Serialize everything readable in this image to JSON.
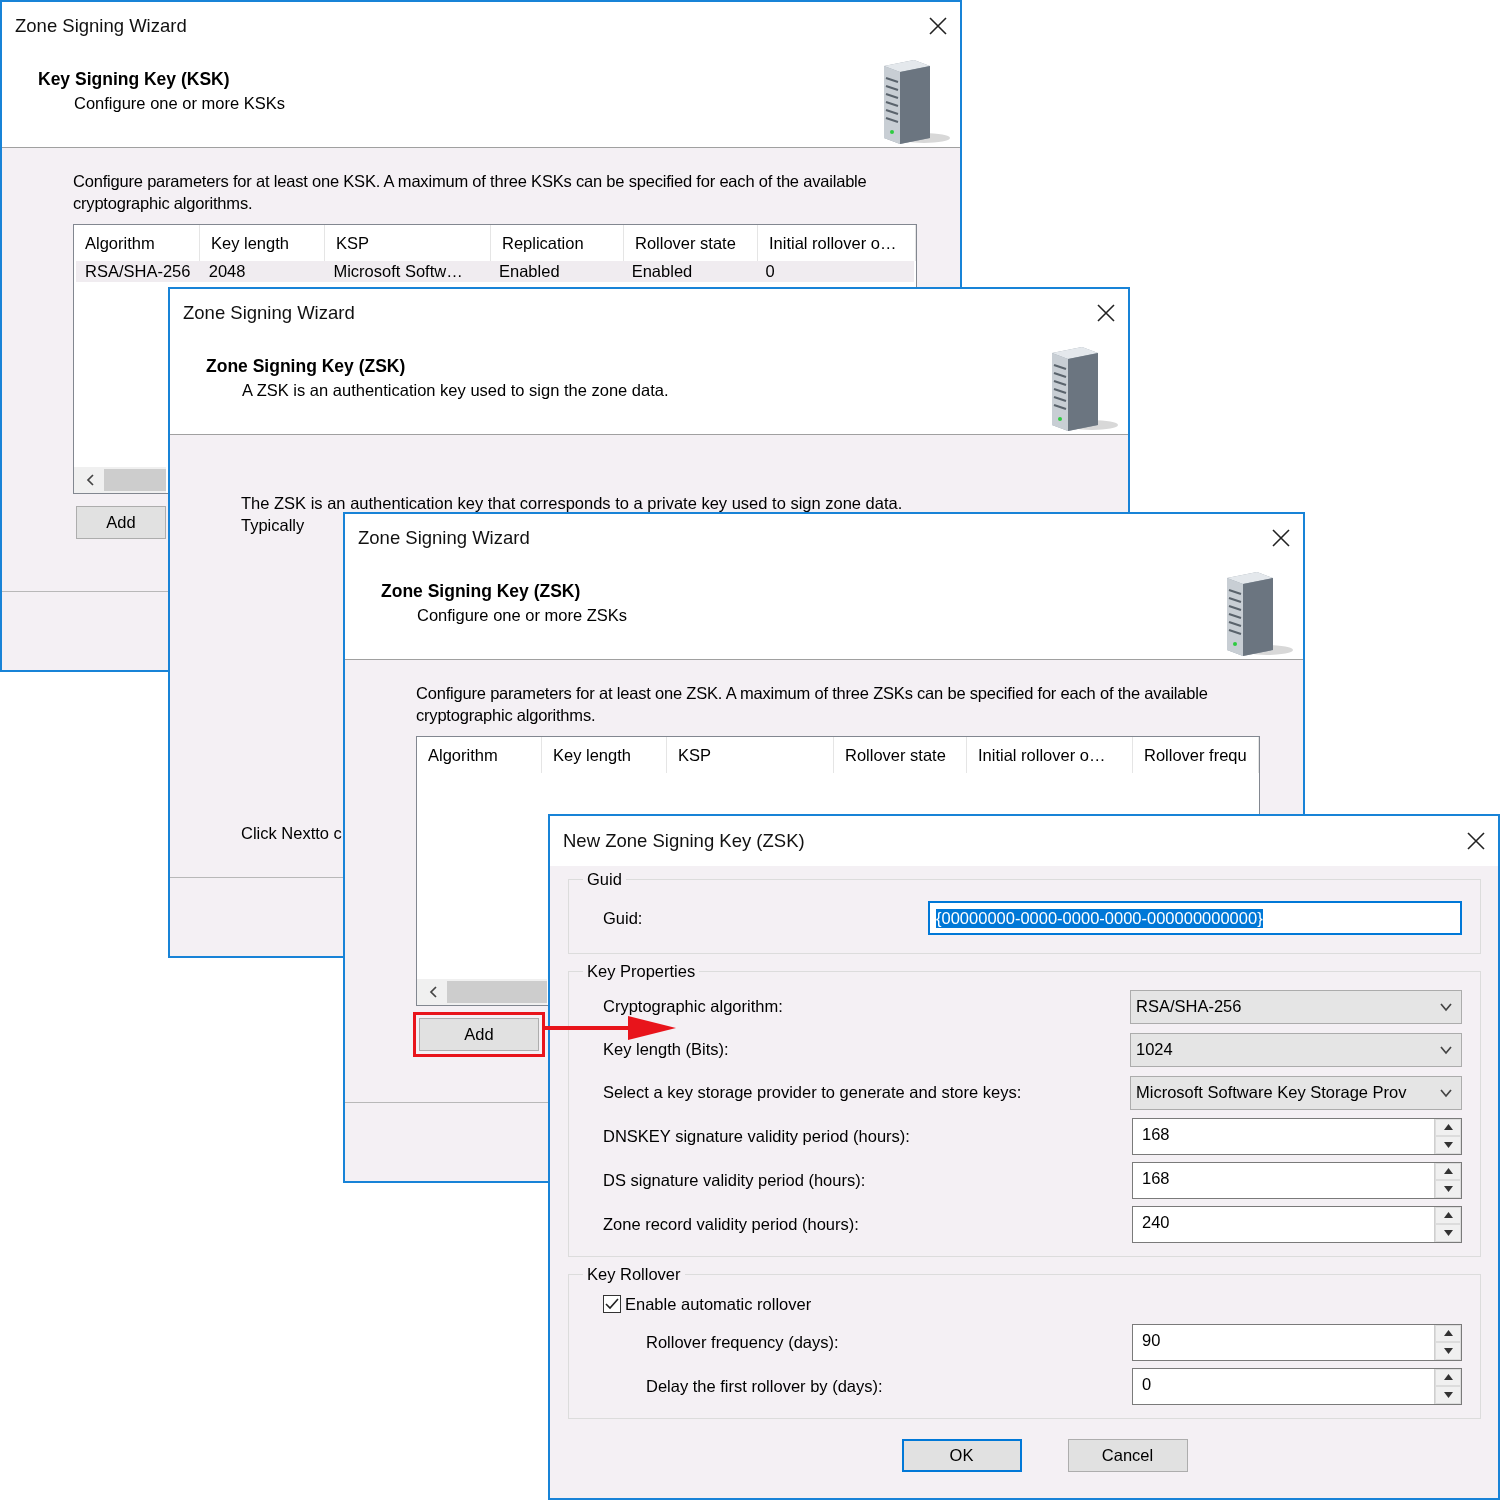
{
  "windows": [
    {
      "kind": "wizard_table",
      "title": "Zone Signing Wizard",
      "heading": "Key Signing Key (KSK)",
      "subheading": "Configure one or more KSKs",
      "description": "Configure parameters for at least one KSK. A maximum of three KSKs can be specified for each of the available cryptographic algorithms.",
      "table": {
        "columns": [
          "Algorithm",
          "Key length",
          "KSP",
          "Replication",
          "Rollover state",
          "Initial rollover o…"
        ],
        "rows": [
          [
            "RSA/SHA-256",
            "2048",
            "Microsoft Softw…",
            "Enabled",
            "Enabled",
            "0"
          ]
        ]
      },
      "add_button": {
        "label": "Add",
        "highlighted": false
      }
    },
    {
      "kind": "wizard_text",
      "title": "Zone Signing Wizard",
      "heading": "Zone Signing Key (ZSK)",
      "subheading": "A ZSK is an authentication key used to sign the zone data.",
      "lines": [
        "The ZSK is an authentication key that corresponds to a private key used to sign zone data.",
        "Typically"
      ],
      "footer_note": "Click Nextto c"
    },
    {
      "kind": "wizard_table",
      "title": "Zone Signing Wizard",
      "heading": "Zone Signing Key (ZSK)",
      "subheading": "Configure one or more ZSKs",
      "description": "Configure parameters for at least one ZSK. A maximum of three ZSKs can be specified for each of the available cryptographic algorithms.",
      "table": {
        "columns": [
          "Algorithm",
          "Key length",
          "KSP",
          "Rollover state",
          "Initial rollover o…",
          "Rollover frequ"
        ]
      },
      "add_button": {
        "label": "Add",
        "highlighted": true
      }
    },
    {
      "kind": "dialog",
      "title": "New Zone Signing Key (ZSK)",
      "groups": [
        {
          "legend": "Guid",
          "fields": [
            {
              "kind": "text",
              "label": "Guid:",
              "value": "{00000000-0000-0000-0000-000000000000}",
              "selected": true
            }
          ]
        },
        {
          "legend": "Key Properties",
          "fields": [
            {
              "kind": "combo",
              "label": "Cryptographic algorithm:",
              "value": "RSA/SHA-256"
            },
            {
              "kind": "combo",
              "label": "Key length (Bits):",
              "value": "1024"
            },
            {
              "kind": "combo",
              "label": "Select a key storage provider to generate and store keys:",
              "value": "Microsoft Software Key Storage Prov"
            },
            {
              "kind": "spin",
              "label": "DNSKEY signature validity period (hours):",
              "value": "168"
            },
            {
              "kind": "spin",
              "label": "DS signature validity period (hours):",
              "value": "168"
            },
            {
              "kind": "spin",
              "label": "Zone record validity period (hours):",
              "value": "240"
            }
          ]
        },
        {
          "legend": "Key Rollover",
          "fields": [
            {
              "kind": "checkbox",
              "label": "Enable automatic rollover",
              "checked": true,
              "children": [
                {
                  "kind": "spin",
                  "label": "Rollover frequency (days):",
                  "value": "90"
                },
                {
                  "kind": "spin",
                  "label": "Delay the first rollover by (days):",
                  "value": "0"
                }
              ]
            }
          ]
        }
      ],
      "buttons": [
        {
          "label": "OK",
          "default": true
        },
        {
          "label": "Cancel",
          "default": false
        }
      ]
    }
  ]
}
